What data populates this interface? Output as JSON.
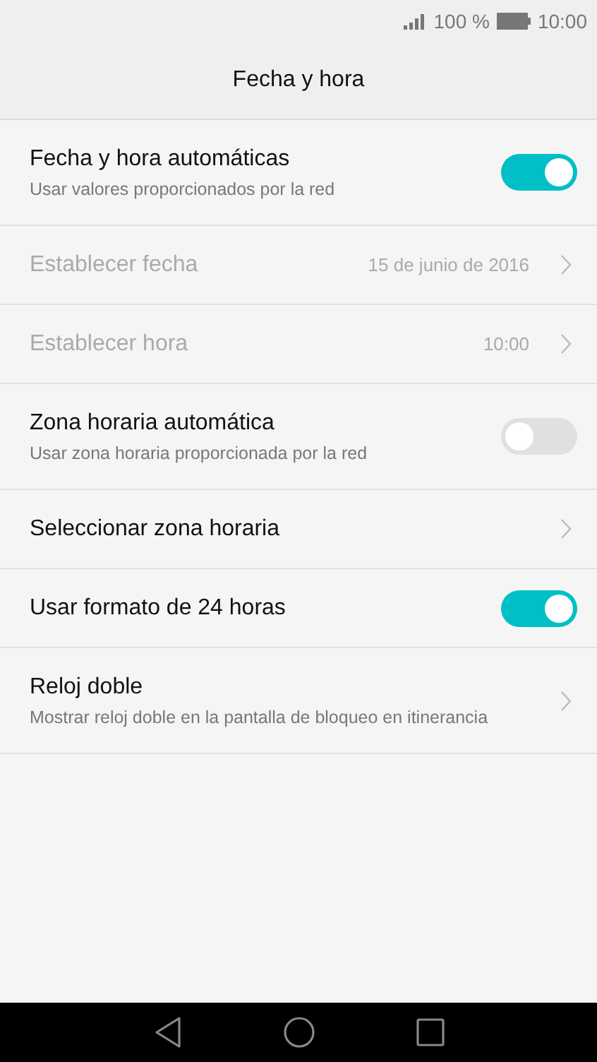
{
  "status_bar": {
    "battery_text": "100 %",
    "time": "10:00"
  },
  "title": "Fecha y hora",
  "settings": [
    {
      "kind": "toggle",
      "title": "Fecha y hora automáticas",
      "subtitle": "Usar valores proporcionados por la red",
      "on": true,
      "disabled": false
    },
    {
      "kind": "link",
      "title": "Establecer fecha",
      "value": "15 de junio de 2016",
      "disabled": true
    },
    {
      "kind": "link",
      "title": "Establecer hora",
      "value": "10:00",
      "disabled": true
    },
    {
      "kind": "toggle",
      "title": "Zona horaria automática",
      "subtitle": "Usar zona horaria proporcionada por la red",
      "on": false,
      "disabled": false
    },
    {
      "kind": "link",
      "title": "Seleccionar zona horaria",
      "disabled": false
    },
    {
      "kind": "toggle",
      "title": "Usar formato de 24 horas",
      "on": true,
      "disabled": false
    },
    {
      "kind": "link",
      "title": "Reloj doble",
      "subtitle": "Mostrar reloj doble en la pantalla de bloqueo en itinerancia",
      "disabled": false
    }
  ]
}
